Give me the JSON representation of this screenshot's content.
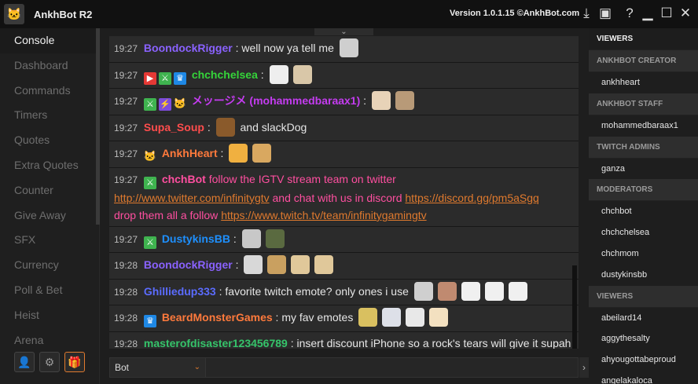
{
  "app": {
    "title": "AnkhBot R2",
    "version": "Version 1.0.1.15 ©AnkhBot.com"
  },
  "sidebar": {
    "items": [
      "Console",
      "Dashboard",
      "Commands",
      "Timers",
      "Quotes",
      "Extra Quotes",
      "Counter",
      "Give Away",
      "SFX",
      "Currency",
      "Poll & Bet",
      "Heist",
      "Arena"
    ]
  },
  "chat": {
    "messages": [
      {
        "time": "19:27",
        "user": "BoondockRigger",
        "color": "#8a62ff",
        "text": "well now ya tell me"
      },
      {
        "time": "19:27",
        "user": "chchchelsea",
        "color": "#35d43a",
        "text": ""
      },
      {
        "time": "19:27",
        "user": "メッージメ (mohammedbaraax1)",
        "color": "#c43cf0",
        "text": ""
      },
      {
        "time": "19:27",
        "user": "Supa_Soup",
        "color": "#ff4d4d",
        "text": "and slackDog"
      },
      {
        "time": "19:27",
        "user": "AnkhHeart",
        "color": "#ff7a3c",
        "text": ""
      },
      {
        "time": "19:27",
        "user": "chchBot",
        "color": "#ff4fa0",
        "text": "follow the IGTV stream team on twitter",
        "link1": "http://www.twitter.com/infinitygtv",
        "mid": "and chat with us in discord",
        "link2": "https://discord.gg/pm5aSgq",
        "end": "drop them all a follow",
        "link3": "https://www.twitch.tv/team/infinitygamingtv"
      },
      {
        "time": "19:27",
        "user": "DustykinsBB",
        "color": "#1e90ff",
        "text": ""
      },
      {
        "time": "19:28",
        "user": "BoondockRigger",
        "color": "#8a62ff",
        "text": ""
      },
      {
        "time": "19:28",
        "user": "Ghilliedup333",
        "color": "#5b6cff",
        "text": "favorite twitch emote? only ones i use"
      },
      {
        "time": "19:28",
        "user": "BeardMonsterGames",
        "color": "#ff7a3c",
        "text": "my fav emotes"
      },
      {
        "time": "19:28",
        "user": "masterofdisaster123456789",
        "color": "#35c46a",
        "text": "insert discount iPhone so a rock's tears will give it supah powers."
      }
    ]
  },
  "input": {
    "selected": "Bot",
    "placeholder": ""
  },
  "viewers": {
    "header": "VIEWERS",
    "sections": [
      {
        "title": "ANKHBOT CREATOR",
        "users": [
          "ankhheart"
        ]
      },
      {
        "title": "ANKHBOT STAFF",
        "users": [
          "mohammedbaraax1"
        ]
      },
      {
        "title": "TWITCH ADMINS",
        "users": [
          "ganza"
        ]
      },
      {
        "title": "MODERATORS",
        "users": [
          "chchbot",
          "chchchelsea",
          "chchmom",
          "dustykinsbb"
        ]
      },
      {
        "title": "VIEWERS",
        "users": [
          "abeilard14",
          "aggythesalty",
          "ahyougottabeproud",
          "angelakaloca"
        ]
      }
    ]
  },
  "icons": {
    "logo": "cat-logo-icon",
    "download": "download-icon",
    "save": "save-icon",
    "help": "help-icon",
    "minimize": "minimize-icon",
    "maximize": "maximize-icon",
    "close": "close-icon"
  },
  "colors": {
    "accent": "#e07a2e",
    "link": "#e07a2e"
  }
}
